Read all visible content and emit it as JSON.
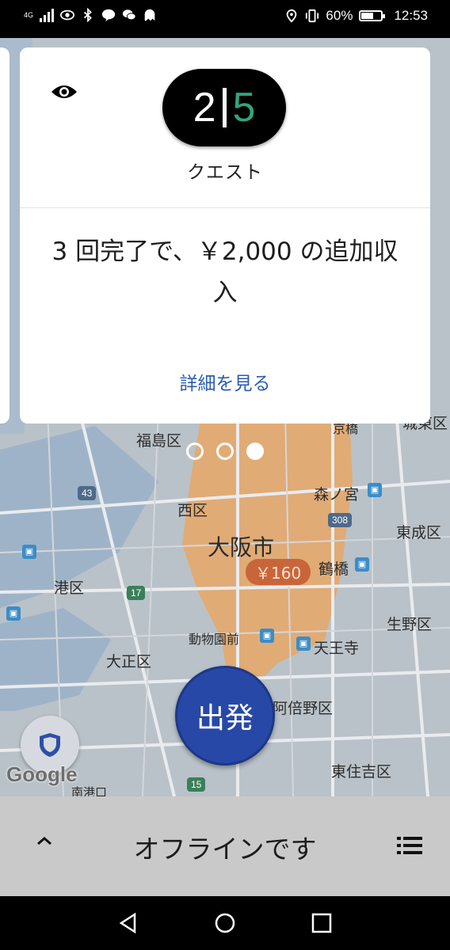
{
  "status_bar": {
    "network": "4G",
    "battery": "60%",
    "battery_level": 0.6,
    "time": "12:53",
    "left_icons": [
      "signal-icon",
      "eye-icon",
      "bluetooth-icon",
      "line-icon",
      "wechat-icon",
      "ghost-icon"
    ],
    "right_icons": [
      "location-icon",
      "vibrate-icon",
      "battery-icon"
    ]
  },
  "quest_card": {
    "completed": "2",
    "total": "5",
    "label": "クエスト",
    "message": "3 回完了で、￥2,000 の追加収入",
    "link": "詳細を見る"
  },
  "pager": {
    "count": 3,
    "active_index": 2
  },
  "map": {
    "labels": {
      "fukushima": "福島区",
      "nishi": "西区",
      "osaka_city": "大阪市",
      "minato": "港区",
      "taisho": "大正区",
      "morinomiya": "森ノ宮",
      "joto": "城東区",
      "higashinari": "東成区",
      "tsuruhashi": "鶴橋",
      "ikuno": "生野区",
      "tennoji": "天王寺",
      "zoo": "動物園前",
      "abeno": "阿倍野区",
      "higashisumiyoshi": "東住吉区",
      "kyobashi": "京橋",
      "minamiko": "南港口"
    },
    "surge_price": "￥160",
    "routes": {
      "r43": "43",
      "r17": "17",
      "r308": "308",
      "r15": "15"
    },
    "google": "Google",
    "colors": {
      "surge_zone": "#e8a766",
      "water": "#9fb3c8",
      "land": "#c4c8cc"
    }
  },
  "go_button": {
    "label": "出発"
  },
  "bottom_bar": {
    "status": "オフラインです"
  }
}
